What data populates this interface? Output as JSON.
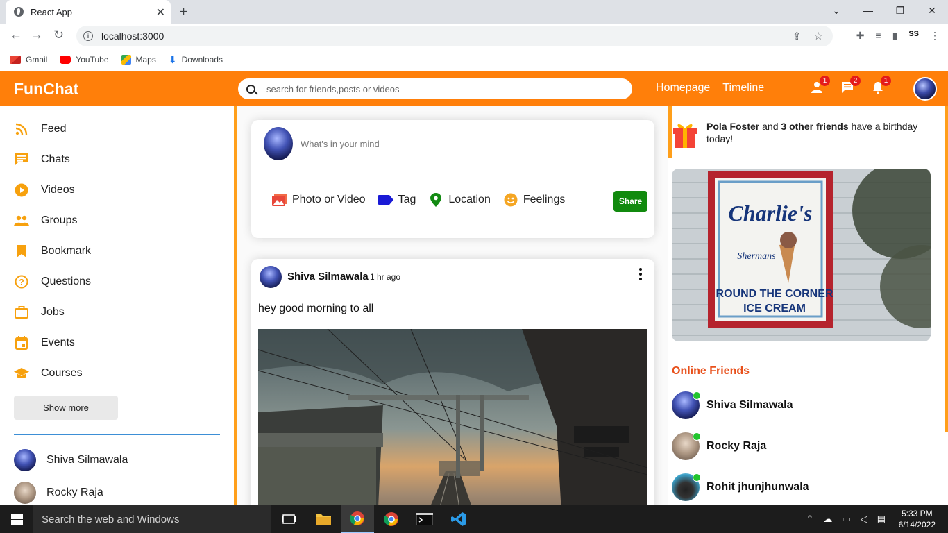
{
  "browser": {
    "tab_title": "React App",
    "url": "localhost:3000",
    "bookmarks": [
      "Gmail",
      "YouTube",
      "Maps",
      "Downloads"
    ]
  },
  "navbar": {
    "logo": "FunChat",
    "search_placeholder": "search for friends,posts or videos",
    "links": [
      "Homepage",
      "Timeline"
    ],
    "badges": {
      "friends": "1",
      "messages": "2",
      "notifications": "1"
    }
  },
  "sidebar": {
    "items": [
      {
        "label": "Feed",
        "icon": "rss-icon"
      },
      {
        "label": "Chats",
        "icon": "chat-icon"
      },
      {
        "label": "Videos",
        "icon": "play-circle-icon"
      },
      {
        "label": "Groups",
        "icon": "group-icon"
      },
      {
        "label": "Bookmark",
        "icon": "bookmark-icon"
      },
      {
        "label": "Questions",
        "icon": "help-circle-icon"
      },
      {
        "label": "Jobs",
        "icon": "briefcase-icon"
      },
      {
        "label": "Events",
        "icon": "calendar-icon"
      },
      {
        "label": "Courses",
        "icon": "school-icon"
      }
    ],
    "show_more": "Show more",
    "friends": [
      "Shiva Silmawala",
      "Rocky Raja"
    ]
  },
  "share": {
    "placeholder": "What's in your mind",
    "options": [
      "Photo or Video",
      "Tag",
      "Location",
      "Feelings"
    ],
    "button": "Share"
  },
  "post": {
    "author": "Shiva Silmawala",
    "time": "1 hr ago",
    "text": "hey good morning to all"
  },
  "rightbar": {
    "birthday": {
      "name": "Pola Foster",
      "joiner": "and",
      "others": "3 other friends",
      "suffix": "have a birthday today!"
    },
    "ad_sign": {
      "line1": "Charlie's",
      "line2": "Shermans",
      "line3": "ROUND THE CORNER",
      "line4": "ICE CREAM"
    },
    "online_title": "Online Friends",
    "online_friends": [
      "Shiva Silmawala",
      "Rocky Raja",
      "Rohit jhunjhunwala"
    ]
  },
  "taskbar": {
    "search_placeholder": "Search the web and Windows",
    "time": "5:33 PM",
    "date": "6/14/2022"
  },
  "colors": {
    "brand_orange": "#ff7f0a",
    "sidebar_icon": "#f7a10e",
    "share_green": "#118a0e",
    "online_title": "#e8501b",
    "online_dot": "#22c42e"
  }
}
